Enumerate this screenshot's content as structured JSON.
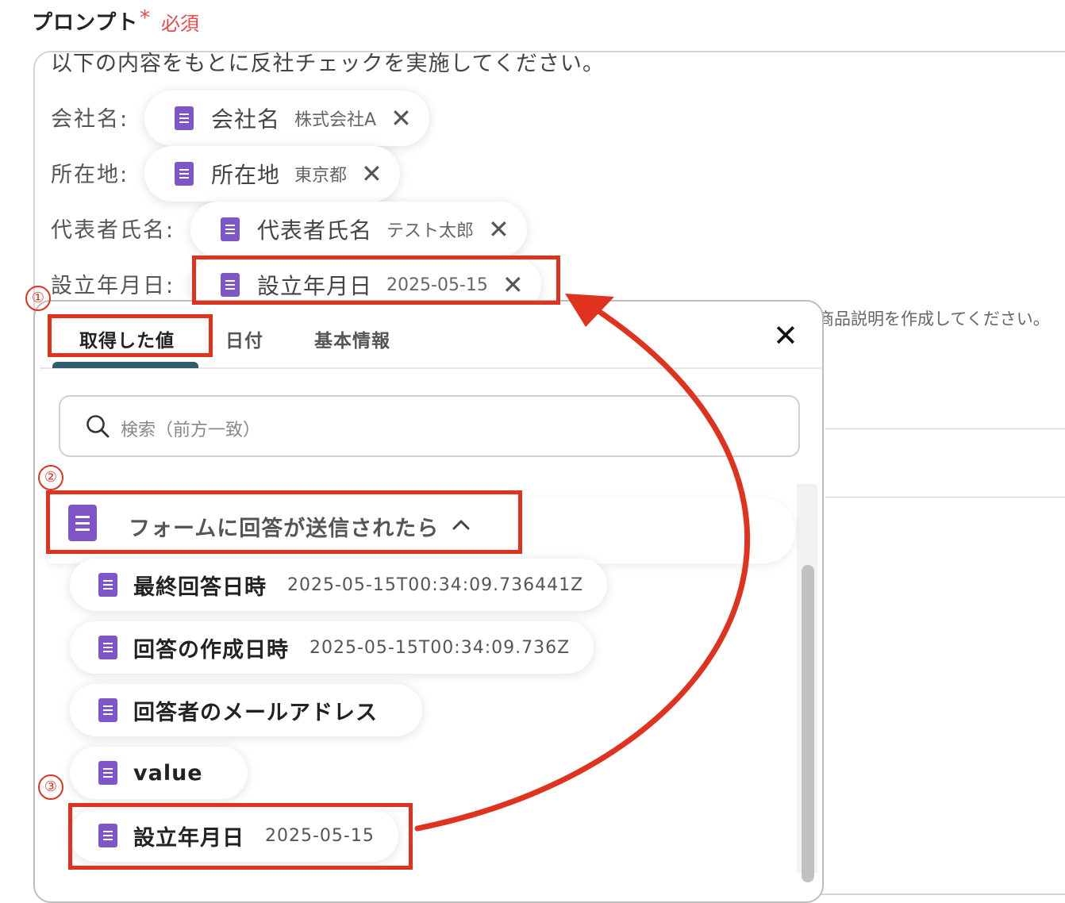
{
  "header": {
    "label": "プロンプト",
    "required_mark": "*",
    "required_text": "必須"
  },
  "prompt": {
    "first_line": "以下の内容をもとに反社チェックを実施してください。",
    "fields": [
      {
        "label": "会社名:",
        "chip_name": "会社名",
        "chip_value": "株式会社A"
      },
      {
        "label": "所在地:",
        "chip_name": "所在地",
        "chip_value": "東京都"
      },
      {
        "label": "代表者氏名:",
        "chip_name": "代表者氏名",
        "chip_value": "テスト太郎"
      },
      {
        "label": "設立年月日:",
        "chip_name": "設立年月日",
        "chip_value": "2025-05-15"
      }
    ],
    "background_text": "商品説明を作成してください。"
  },
  "panel": {
    "tabs": [
      {
        "label": "取得した値"
      },
      {
        "label": "日付"
      },
      {
        "label": "基本情報"
      }
    ],
    "search_placeholder": "検索（前方一致）",
    "group_title": "フォームに回答が送信されたら",
    "items": [
      {
        "name": "最終回答日時",
        "value": "2025-05-15T00:34:09.736441Z"
      },
      {
        "name": "回答の作成日時",
        "value": "2025-05-15T00:34:09.736Z"
      },
      {
        "name": "回答者のメールアドレス",
        "value": ""
      },
      {
        "name": "value",
        "value": ""
      },
      {
        "name": "設立年月日",
        "value": "2025-05-15"
      }
    ]
  },
  "annotations": {
    "step1": "①",
    "step2": "②",
    "step3": "③",
    "color": "#e0331f"
  },
  "icons": {
    "field_icon": "google-forms-doc-icon",
    "close": "close-icon",
    "search": "search-icon",
    "chevron": "chevron-up-icon"
  },
  "colors": {
    "required": "#e84a4a",
    "doc_icon": "#7f56c7",
    "tab_underline": "#2f5b6d"
  }
}
